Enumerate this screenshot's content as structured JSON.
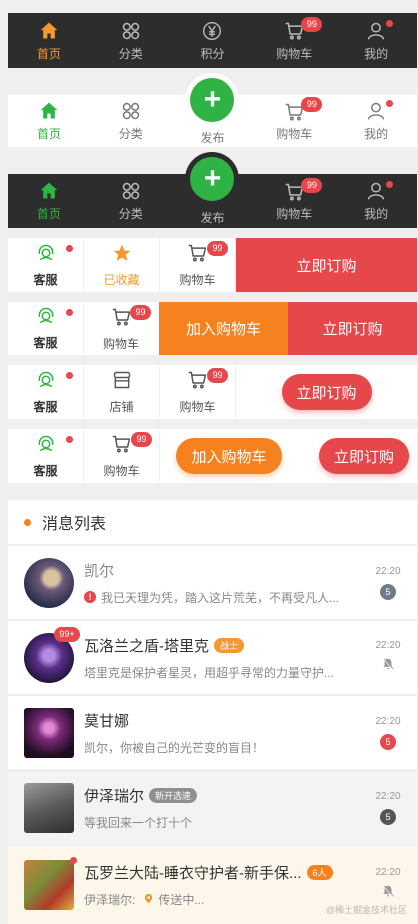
{
  "tabbar_dark": {
    "items": [
      {
        "label": "首页",
        "icon": "home-icon"
      },
      {
        "label": "分类",
        "icon": "category-icon"
      },
      {
        "label": "积分",
        "icon": "yen-icon"
      },
      {
        "label": "购物车",
        "icon": "cart-icon",
        "badge": "99"
      },
      {
        "label": "我的",
        "icon": "user-icon"
      }
    ]
  },
  "tabbar_light": {
    "items": [
      {
        "label": "首页",
        "icon": "home-icon"
      },
      {
        "label": "分类",
        "icon": "category-icon"
      },
      {
        "label": "发布",
        "icon": "plus-icon"
      },
      {
        "label": "购物车",
        "icon": "cart-icon",
        "badge": "99"
      },
      {
        "label": "我的",
        "icon": "user-icon"
      }
    ]
  },
  "tabbar_dark_fab": {
    "items": [
      {
        "label": "首页",
        "icon": "home-icon"
      },
      {
        "label": "分类",
        "icon": "category-icon"
      },
      {
        "label": "发布",
        "icon": "plus-icon"
      },
      {
        "label": "购物车",
        "icon": "cart-icon",
        "badge": "99"
      },
      {
        "label": "我的",
        "icon": "user-icon"
      }
    ]
  },
  "goods_bar_1": {
    "service": "客服",
    "favorite": "已收藏",
    "cart": "购物车",
    "cart_badge": "99",
    "buy": "立即订购"
  },
  "goods_bar_2": {
    "service": "客服",
    "cart": "购物车",
    "cart_badge": "99",
    "add_cart": "加入购物车",
    "buy": "立即订购"
  },
  "goods_bar_3": {
    "service": "客服",
    "shop": "店铺",
    "cart": "购物车",
    "cart_badge": "99",
    "buy": "立即订购"
  },
  "goods_bar_4": {
    "service": "客服",
    "cart": "购物车",
    "cart_badge": "99",
    "add_cart": "加入购物车",
    "buy": "立即订购"
  },
  "messages": {
    "title": "消息列表",
    "items": [
      {
        "name": "凯尔",
        "text": "我已天理为凭，踏入这片荒芜，不再受凡人...",
        "time": "22:20",
        "count": "5"
      },
      {
        "name": "瓦洛兰之盾-塔里克",
        "tag": "战士",
        "avatar_badge": "99+",
        "text": "塔里克是保护者星灵，用超乎寻常的力量守护...",
        "time": "22:20"
      },
      {
        "name": "莫甘娜",
        "text": "凯尔，你被自己的光芒变的盲目！",
        "time": "22:20",
        "count": "5"
      },
      {
        "name": "伊泽瑞尔",
        "tag": "新开选速",
        "text": "等我回来一个打十个",
        "time": "22:20",
        "count": "5"
      },
      {
        "name": "瓦罗兰大陆-睡衣守护者-新手保...",
        "tag": "6人",
        "sender": "伊泽瑞尔:",
        "text": "传送中...",
        "time": "22:20"
      }
    ]
  },
  "watermark": "@稀土掘金技术社区",
  "colors": {
    "orange": "#f29a2e",
    "green": "#2fb344",
    "red": "#e5474b",
    "dark_bar": "#2d2d2d"
  }
}
